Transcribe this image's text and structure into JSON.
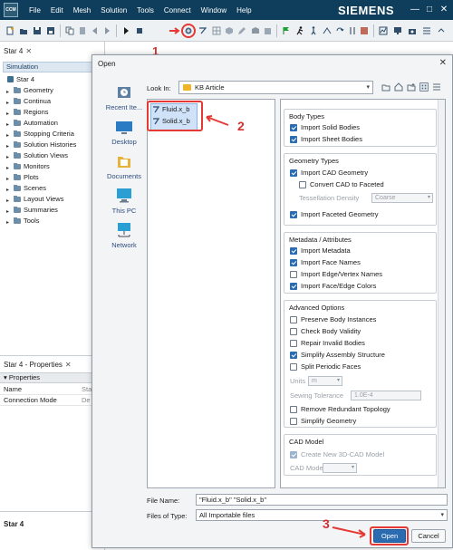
{
  "app": {
    "logo_text": "CCM",
    "brand": "SIEMENS",
    "menu": [
      "File",
      "Edit",
      "Mesh",
      "Solution",
      "Tools",
      "Connect",
      "Window",
      "Help"
    ],
    "window_buttons": [
      "—",
      "□",
      "✕"
    ]
  },
  "toolbar": {
    "icons": [
      "new-file-icon",
      "open-file-icon",
      "save-icon",
      "save-as-icon",
      "copy-icon",
      "paste-icon",
      "step-back-icon",
      "play-icon",
      "stop-icon",
      "import-geometry-icon",
      "import-surface-icon",
      "grid-icon",
      "cube-icon",
      "pencil-icon",
      "surface-icon",
      "flag-icon",
      "run-icon",
      "step-icon",
      "pause-icon",
      "clear-icon",
      "record-icon",
      "chart-icon",
      "monitor-icon",
      "camera-icon",
      "collapse-icon"
    ],
    "annotation_number": "1"
  },
  "left": {
    "tab_title": "Star 4",
    "tab_close": "✕",
    "section_header": "Simulation",
    "root": "Star 4",
    "tree": [
      "Geometry",
      "Continua",
      "Regions",
      "Automation",
      "Stopping Criteria",
      "Solution Histories",
      "Solution Views",
      "Monitors",
      "Plots",
      "Scenes",
      "Layout Views",
      "Summaries",
      "Tools"
    ],
    "properties_tab": "Star 4 - Properties",
    "properties_header": "Properties",
    "properties_rows": [
      {
        "name": "Name",
        "value": "Sta"
      },
      {
        "name": "Connection Mode",
        "value": "De"
      }
    ],
    "bottom_label": "Star 4"
  },
  "dialog": {
    "title": "Open",
    "close": "✕",
    "places": [
      "Recent Ite...",
      "Desktop",
      "Documents",
      "This PC",
      "Network"
    ],
    "look_in_label": "Look In:",
    "look_in_value": "KB Article",
    "files": [
      "Fluid.x_b",
      "Solid.x_b"
    ],
    "annotation_2": "2",
    "annotation_3": "3",
    "groups": {
      "body_types": {
        "title": "Body Types",
        "options": [
          {
            "label": "Import Solid Bodies",
            "checked": true
          },
          {
            "label": "Import Sheet Bodies",
            "checked": true
          }
        ]
      },
      "geometry_types": {
        "title": "Geometry Types",
        "import_cad": "Import CAD Geometry",
        "convert_cad": "Convert CAD to Faceted",
        "tessellation_label": "Tessellation Density",
        "tessellation_value": "Coarse",
        "import_faceted": "Import Faceted Geometry"
      },
      "metadata": {
        "title": "Metadata / Attributes",
        "options": [
          {
            "label": "Import Metadata",
            "checked": true
          },
          {
            "label": "Import Face Names",
            "checked": true
          },
          {
            "label": "Import Edge/Vertex Names",
            "checked": false
          },
          {
            "label": "Import Face/Edge Colors",
            "checked": true
          }
        ]
      },
      "advanced": {
        "title": "Advanced Options",
        "options": [
          {
            "label": "Preserve Body Instances",
            "checked": false
          },
          {
            "label": "Check Body Validity",
            "checked": false
          },
          {
            "label": "Repair Invalid Bodies",
            "checked": false
          },
          {
            "label": "Simplify Assembly Structure",
            "checked": true
          },
          {
            "label": "Split Periodic Faces",
            "checked": false
          }
        ],
        "units_label": "Units",
        "units_value": "m",
        "sewing_label": "Sewing Tolerance",
        "sewing_value": "1.0E-4",
        "remove_redundant": "Remove Redundant Topology",
        "simplify_geometry": "Simplify Geometry"
      },
      "cad_model": {
        "title": "CAD Model",
        "create_new": "Create New 3D-CAD Model",
        "model_label": "CAD Model"
      }
    },
    "file_name_label": "File Name:",
    "file_name_value": "\"Fluid.x_b\" \"Solid.x_b\"",
    "file_type_label": "Files of Type:",
    "file_type_value": "All Importable files",
    "open_button": "Open",
    "cancel_button": "Cancel"
  },
  "colors": {
    "titlebar": "#0e3e5c",
    "accent": "#2b6cb0",
    "annotation": "#e53935"
  }
}
